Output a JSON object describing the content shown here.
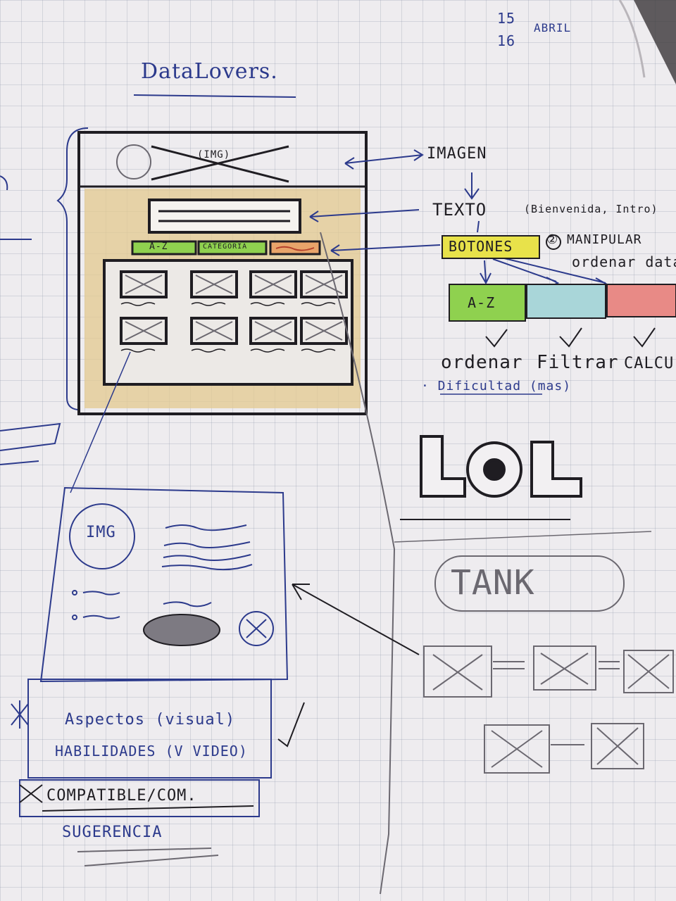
{
  "date": {
    "day1": "15",
    "day2": "16",
    "month": "ABRIL"
  },
  "title": "DataLovers.",
  "wireframe": {
    "header_img": "(IMG)",
    "btn_az": "A-Z",
    "btn_categoria": "CATEGORIA"
  },
  "annotations": {
    "imagen": "IMAGEN",
    "texto": "TEXTO",
    "texto_note": "(Bienvenida, Intro)",
    "botones": "BOTONES",
    "manipular": "② MANIPULAR",
    "ordenar_data": "ordenar data",
    "btn_az": "A-Z",
    "ordenar": "ordenar",
    "filtrar": "Filtrar",
    "calcular": "CALCU",
    "dificultad": "· Dificultad (mas)",
    "lol": "LOL",
    "tank": "TANK"
  },
  "detail_card": {
    "img": "IMG",
    "aspectos": "Aspectos (visual)",
    "habilidades": "HABILIDADES (V VIDEO)",
    "compatible": "COMPATIBLE/COM.",
    "sugerencia": "SUGERENCIA"
  },
  "colors": {
    "ink_blue": "#2c3a8c",
    "marker_black": "#1f1d22",
    "frame_fill": "#e3c98f",
    "btn_green": "#8fd14f",
    "btn_blue": "#a9d6d9",
    "btn_red": "#e88a86",
    "highlight_yellow": "#e8e24a"
  }
}
